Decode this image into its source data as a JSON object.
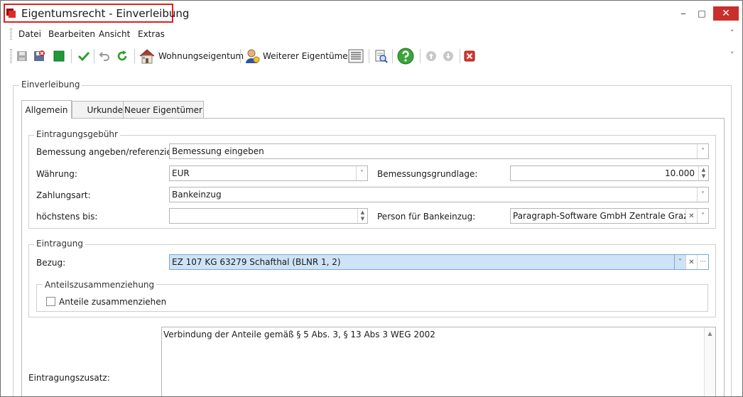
{
  "window": {
    "title": "Eigentumsrecht - Einverleibung",
    "minimize": "‒",
    "maximize": "□",
    "close": "✕"
  },
  "menu": {
    "items": [
      "Datei",
      "Bearbeiten",
      "Ansicht",
      "Extras"
    ],
    "overflow": "˅"
  },
  "toolbar": {
    "wohnungseigentum_label": "Wohnungseigentum",
    "weiterer_eigentuemer_label": "Weiterer Eigentümer?",
    "overflow": "˅",
    "icons": [
      "save-disabled-icon",
      "save-close-icon",
      "green-square-icon",
      "checkmark-icon",
      "undo-icon",
      "refresh-icon",
      "house-icon",
      "person-icon",
      "document-list-icon",
      "print-preview-icon",
      "help-icon",
      "arrow-up-icon",
      "arrow-down-icon",
      "cancel-icon"
    ],
    "colors": {
      "check": "#2e9e2e",
      "help": "#3aa63a",
      "cancel": "#d9352f",
      "save_red": "#c42828",
      "green_square": "#1f9a3a"
    }
  },
  "main_group": {
    "legend": "Einverleibung"
  },
  "tabs": [
    "Allgemein",
    "Urkunden",
    "Neuer Eigentümer"
  ],
  "eintragungsgebuehr": {
    "legend": "Eintragungsgebühr",
    "bemessung_label": "Bemessung angeben/referenzieren:",
    "bemessung_value": "Bemessung eingeben",
    "waehrung_label": "Währung:",
    "waehrung_value": "EUR",
    "bemessungsgrundlage_label": "Bemessungsgrundlage:",
    "bemessungsgrundlage_value": "10.000",
    "zahlungsart_label": "Zahlungsart:",
    "zahlungsart_value": "Bankeinzug",
    "hoechstens_label": "höchstens bis:",
    "hoechstens_value": "",
    "person_label": "Person für Bankeinzug:",
    "person_value": "Paragraph-Software GmbH Zentrale Graz"
  },
  "eintragung": {
    "legend": "Eintragung",
    "bezug_label": "Bezug:",
    "bezug_value": "EZ 107 KG 63279 Schafthal (BLNR 1, 2)",
    "anteils_legend": "Anteilszusammenziehung",
    "anteile_label": "Anteile zusammenziehen",
    "anteile_checked": false
  },
  "zusatz": {
    "label": "Eintragungszusatz:",
    "value": "Verbindung der Anteile gemäß § 5 Abs. 3, § 13 Abs  3 WEG 2002"
  },
  "glyphs": {
    "dropdown": "˅",
    "clear": "✕",
    "ellipsis": "···",
    "spin_up": "▲",
    "spin_down": "▼",
    "scroll_up": "▲"
  }
}
